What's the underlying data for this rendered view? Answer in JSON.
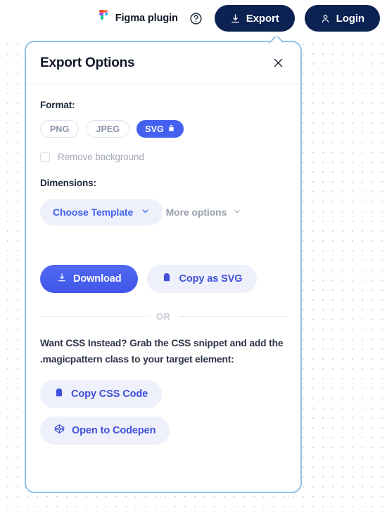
{
  "topbar": {
    "brand_label": "Figma plugin",
    "brand_icon": "figma-logo",
    "help_icon": "question-circle-icon",
    "export_label": "Export",
    "export_icon": "download-icon",
    "login_label": "Login",
    "login_icon": "user-icon",
    "button_color": "#0c2252"
  },
  "dialog": {
    "title": "Export Options",
    "close_icon": "close-icon",
    "border_color": "#8fc0e6",
    "format": {
      "label": "Format:",
      "options": [
        {
          "label": "PNG",
          "selected": false
        },
        {
          "label": "JPEG",
          "selected": false
        },
        {
          "label": "SVG",
          "selected": true,
          "icon": "lock-icon"
        }
      ],
      "selected_value": "SVG",
      "accent_color": "#4361ee"
    },
    "remove_background": {
      "label": "Remove background",
      "checked": false,
      "disabled": true
    },
    "dimensions": {
      "label": "Dimensions:",
      "template_button_label": "Choose Template",
      "template_chevron_icon": "chevron-down-icon"
    },
    "more_options": {
      "label": "More options",
      "chevron_icon": "chevron-down-icon"
    },
    "actions": {
      "download_label": "Download",
      "download_icon": "download-icon",
      "copy_svg_label": "Copy as SVG",
      "copy_svg_icon": "clipboard-icon"
    },
    "divider_text": "OR",
    "css_note": "Want CSS Instead? Grab the CSS snippet and add the .magicpattern class to your target element:",
    "bottom_actions": {
      "copy_css_label": "Copy CSS Code",
      "copy_css_icon": "clipboard-icon",
      "codepen_label": "Open to Codepen",
      "codepen_icon": "codepen-icon"
    }
  }
}
